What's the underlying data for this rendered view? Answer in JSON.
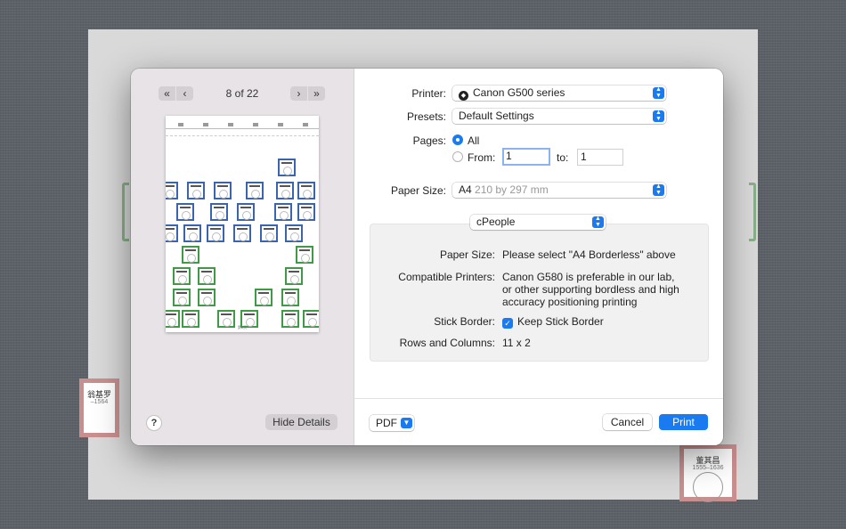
{
  "background_cards": [
    {
      "name": "翁基罗",
      "dates": "–1564"
    },
    {
      "name": "董其昌",
      "dates": "1555–1636"
    }
  ],
  "nav": {
    "first_label": "«",
    "prev_label": "‹",
    "next_label": "›",
    "last_label": "»",
    "page_indicator": "8 of 22"
  },
  "preview": {
    "footer": "第8页"
  },
  "left_footer": {
    "help_label": "?",
    "hide_details_label": "Hide Details"
  },
  "printer": {
    "label": "Printer:",
    "value": "Canon G500 series",
    "glyph": "◆"
  },
  "presets": {
    "label": "Presets:",
    "value": "Default Settings"
  },
  "pages": {
    "label": "Pages:",
    "all_label": "All",
    "from_label": "From:",
    "from_value": "1",
    "to_label": "to:",
    "to_value": "1",
    "selected": "All"
  },
  "paper_size": {
    "label": "Paper Size:",
    "value": "A4",
    "detail": "210 by 297 mm"
  },
  "section_popup": {
    "value": "cPeople"
  },
  "info": {
    "paper_size_label": "Paper Size:",
    "paper_size_value": "Please select \"A4 Borderless\" above",
    "compatible_label": "Compatible Printers:",
    "compatible_line1": "Canon G580 is preferable in our lab,",
    "compatible_line2": "or other supporting bordless and high",
    "compatible_line3": "accuracy positioning printing",
    "stick_label": "Stick Border:",
    "stick_value": "Keep Stick Border",
    "stick_checked": true,
    "rows_label": "Rows and Columns:",
    "rows_value": "11 x 2"
  },
  "bottom": {
    "pdf_label": "PDF",
    "cancel_label": "Cancel",
    "print_label": "Print"
  },
  "colors": {
    "accent": "#1a7af0",
    "card_blue": "#3a64ad",
    "card_green": "#3e9a45",
    "card_red": "#c98f8f"
  },
  "icons": {
    "stepper": "chevron-updown-icon",
    "pdf": "chevron-down-icon",
    "check": "checkmark-icon"
  }
}
